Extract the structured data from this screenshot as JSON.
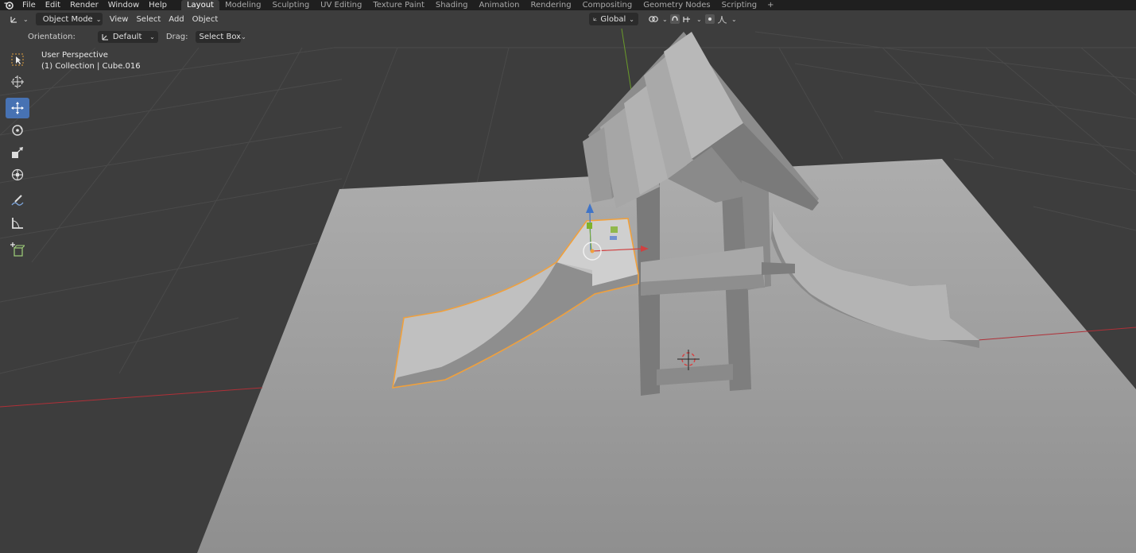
{
  "menu": {
    "items": [
      {
        "label": "File"
      },
      {
        "label": "Edit"
      },
      {
        "label": "Render"
      },
      {
        "label": "Window"
      },
      {
        "label": "Help"
      }
    ]
  },
  "workspaces": {
    "tabs": [
      {
        "label": "Layout",
        "active": true
      },
      {
        "label": "Modeling"
      },
      {
        "label": "Sculpting"
      },
      {
        "label": "UV Editing"
      },
      {
        "label": "Texture Paint"
      },
      {
        "label": "Shading"
      },
      {
        "label": "Animation"
      },
      {
        "label": "Rendering"
      },
      {
        "label": "Compositing"
      },
      {
        "label": "Geometry Nodes"
      },
      {
        "label": "Scripting"
      }
    ],
    "add": "+"
  },
  "viewport_header": {
    "mode": "Object Mode",
    "menus": [
      "View",
      "Select",
      "Add",
      "Object"
    ],
    "transform_orientation": "Global"
  },
  "tool_settings": {
    "orientation_label": "Orientation:",
    "orientation_value": "Default",
    "drag_label": "Drag:",
    "drag_value": "Select Box"
  },
  "overlay": {
    "view_name": "User Perspective",
    "object_info": "(1) Collection | Cube.016"
  },
  "toolbar": {
    "tools": [
      "select-box",
      "cursor",
      "move",
      "rotate",
      "scale",
      "transform",
      "annotate",
      "measure",
      "add-cube"
    ],
    "active": "move"
  },
  "colors": {
    "accent": "#4772b3",
    "selection_outline": "#f0a03c",
    "x_axis": "#c8343c",
    "y_axis": "#7fb22a",
    "z_axis": "#3f74c8",
    "viewport_bg": "#3d3d3d",
    "ground": "#9a9a9a"
  }
}
